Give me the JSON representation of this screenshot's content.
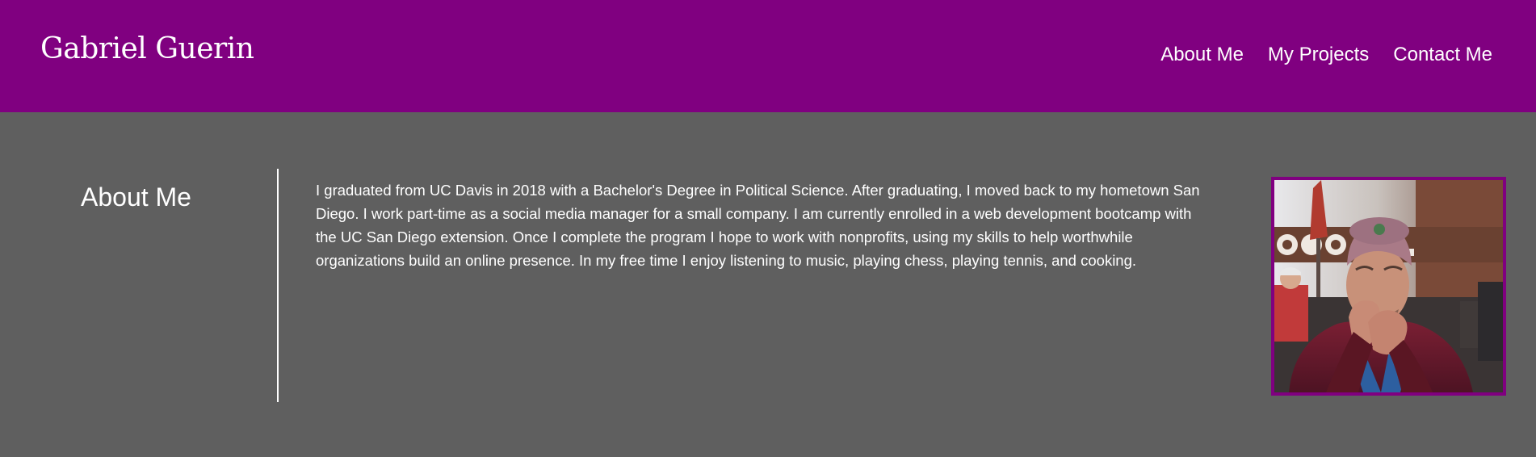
{
  "header": {
    "title": "Gabriel Guerin",
    "nav": [
      {
        "label": "About Me"
      },
      {
        "label": "My Projects"
      },
      {
        "label": "Contact Me"
      }
    ]
  },
  "about": {
    "heading": "About Me",
    "text": "I graduated from UC Davis in 2018 with a Bachelor's Degree in Political Science. After graduating, I moved back to my hometown San Diego. I work part-time as a social media manager for a small company. I am currently enrolled in a web development bootcamp with the UC San Diego extension. Once I complete the program I hope to work with nonprofits, using my skills to help worthwhile organizations build an online presence. In my free time I enjoy listening to music, playing chess, playing tennis, and cooking."
  },
  "colors": {
    "header_background": "#800080",
    "page_background": "#5f5f5f",
    "text": "#ffffff",
    "photo_border": "#800080"
  }
}
